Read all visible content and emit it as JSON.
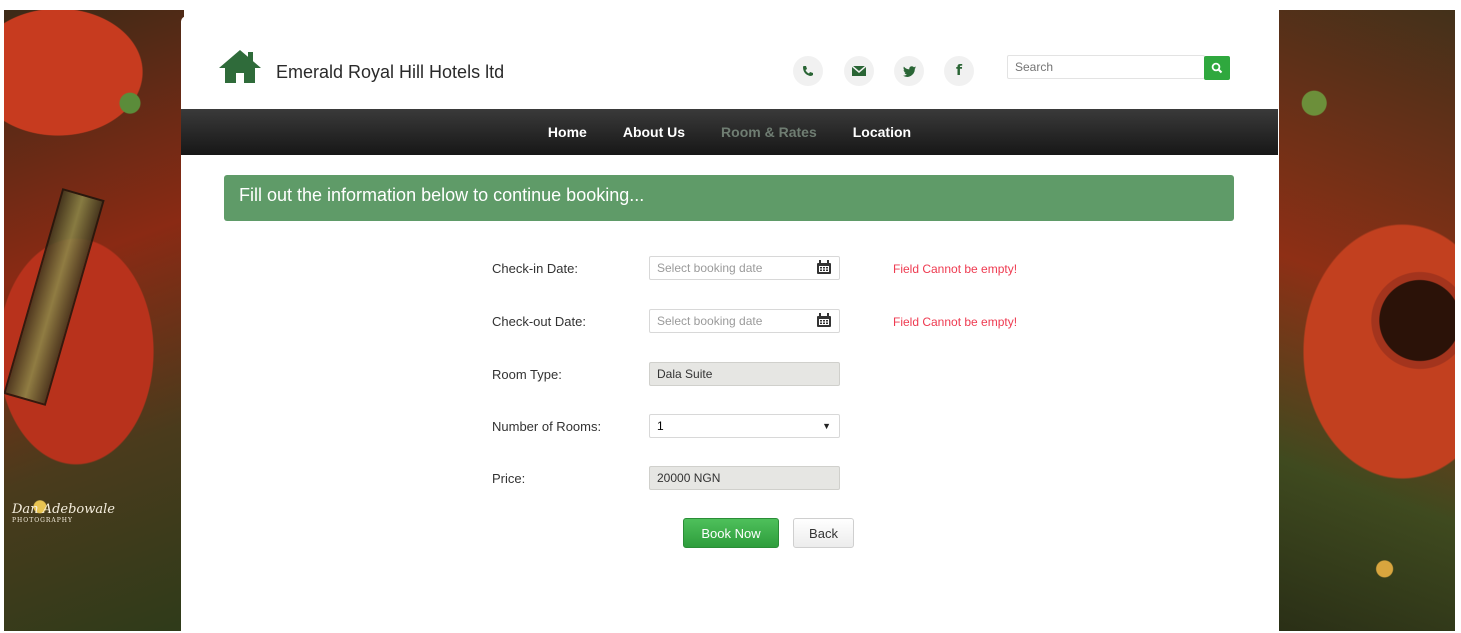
{
  "header": {
    "brand": "Emerald Royal Hill Hotels ltd",
    "social_icons": [
      "phone-icon",
      "envelope-icon",
      "twitter-icon",
      "facebook-icon"
    ],
    "search_placeholder": "Search"
  },
  "nav": {
    "items": [
      {
        "label": "Home"
      },
      {
        "label": "About Us"
      },
      {
        "label": "Room & Rates",
        "active": true
      },
      {
        "label": "Location"
      }
    ]
  },
  "banner": {
    "text": "Fill out the information below to continue booking..."
  },
  "form": {
    "checkin": {
      "label": "Check-in Date:",
      "placeholder": "Select booking date",
      "error": "Field Cannot be empty!"
    },
    "checkout": {
      "label": "Check-out Date:",
      "placeholder": "Select booking date",
      "error": "Field Cannot be empty!"
    },
    "room_type": {
      "label": "Room Type:",
      "value": "Dala Suite"
    },
    "rooms": {
      "label": "Number of Rooms:",
      "value": "1"
    },
    "price": {
      "label": "Price:",
      "value": "20000 NGN"
    }
  },
  "buttons": {
    "book": "Book Now",
    "back": "Back"
  },
  "watermark": {
    "line1": "Dan Adebowale",
    "line2": "PHOTOGRAPHY"
  },
  "colors": {
    "accent": "#2fa83e",
    "banner": "#5f9b68",
    "error": "#ee3a50",
    "navbar": "#1f1f1f"
  }
}
